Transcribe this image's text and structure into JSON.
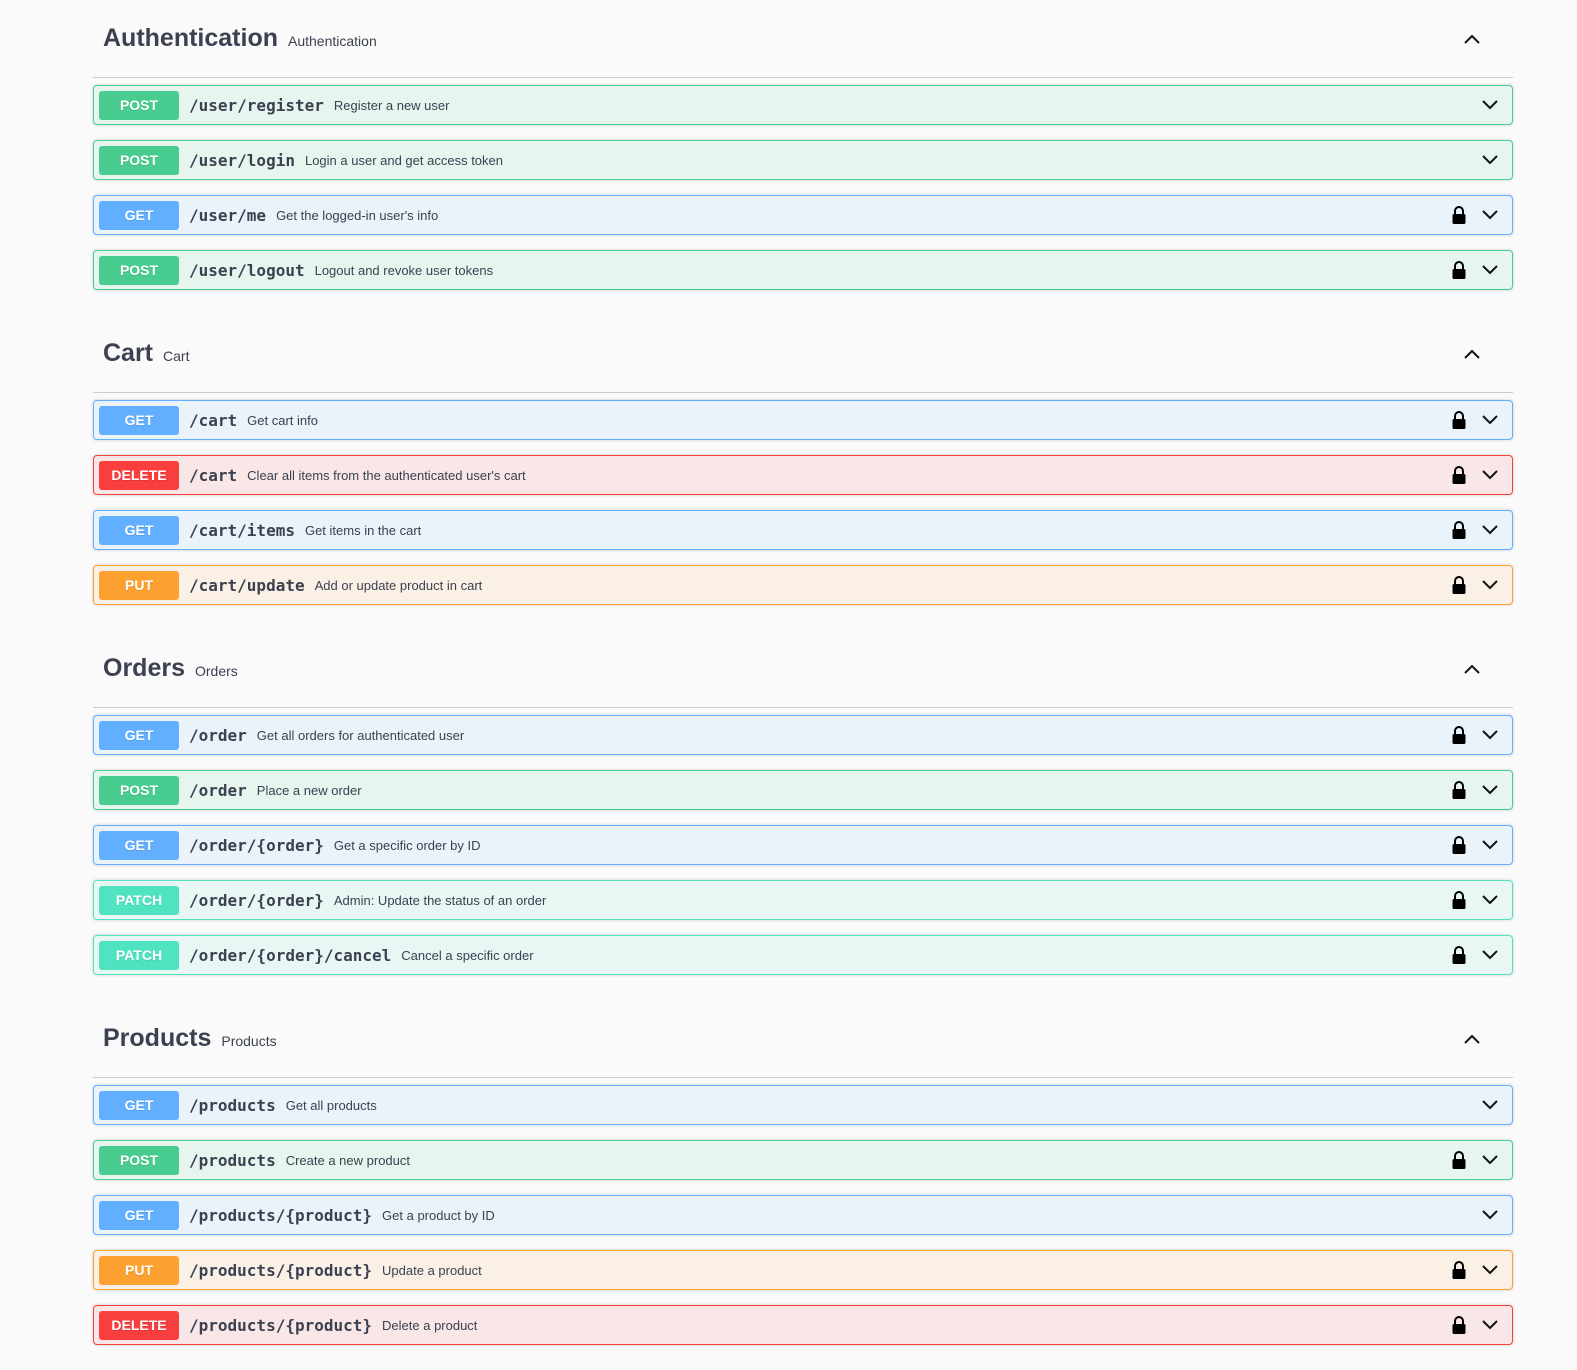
{
  "sections": [
    {
      "title": "Authentication",
      "description": "Authentication",
      "ops": [
        {
          "method": "POST",
          "cls": "post",
          "path": "/user/register",
          "summary": "Register a new user",
          "locked": false
        },
        {
          "method": "POST",
          "cls": "post",
          "path": "/user/login",
          "summary": "Login a user and get access token",
          "locked": false
        },
        {
          "method": "GET",
          "cls": "get",
          "path": "/user/me",
          "summary": "Get the logged-in user's info",
          "locked": true
        },
        {
          "method": "POST",
          "cls": "post",
          "path": "/user/logout",
          "summary": "Logout and revoke user tokens",
          "locked": true
        }
      ]
    },
    {
      "title": "Cart",
      "description": "Cart",
      "ops": [
        {
          "method": "GET",
          "cls": "get",
          "path": "/cart",
          "summary": "Get cart info",
          "locked": true
        },
        {
          "method": "DELETE",
          "cls": "delete",
          "path": "/cart",
          "summary": "Clear all items from the authenticated user's cart",
          "locked": true
        },
        {
          "method": "GET",
          "cls": "get",
          "path": "/cart/items",
          "summary": "Get items in the cart",
          "locked": true
        },
        {
          "method": "PUT",
          "cls": "put",
          "path": "/cart/update",
          "summary": "Add or update product in cart",
          "locked": true
        }
      ]
    },
    {
      "title": "Orders",
      "description": "Orders",
      "ops": [
        {
          "method": "GET",
          "cls": "get",
          "path": "/order",
          "summary": "Get all orders for authenticated user",
          "locked": true
        },
        {
          "method": "POST",
          "cls": "post",
          "path": "/order",
          "summary": "Place a new order",
          "locked": true
        },
        {
          "method": "GET",
          "cls": "get",
          "path": "/order/{order}",
          "summary": "Get a specific order by ID",
          "locked": true
        },
        {
          "method": "PATCH",
          "cls": "patch",
          "path": "/order/{order}",
          "summary": "Admin: Update the status of an order",
          "locked": true
        },
        {
          "method": "PATCH",
          "cls": "patch",
          "path": "/order/{order}/cancel",
          "summary": "Cancel a specific order",
          "locked": true
        }
      ]
    },
    {
      "title": "Products",
      "description": "Products",
      "ops": [
        {
          "method": "GET",
          "cls": "get",
          "path": "/products",
          "summary": "Get all products",
          "locked": false
        },
        {
          "method": "POST",
          "cls": "post",
          "path": "/products",
          "summary": "Create a new product",
          "locked": true
        },
        {
          "method": "GET",
          "cls": "get",
          "path": "/products/{product}",
          "summary": "Get a product by ID",
          "locked": false
        },
        {
          "method": "PUT",
          "cls": "put",
          "path": "/products/{product}",
          "summary": "Update a product",
          "locked": true
        },
        {
          "method": "DELETE",
          "cls": "delete",
          "path": "/products/{product}",
          "summary": "Delete a product",
          "locked": true
        }
      ]
    }
  ],
  "colors": {
    "get": "#61affe",
    "post": "#49cc90",
    "delete": "#f93e3e",
    "put": "#fca130",
    "patch": "#50e3c2"
  },
  "icons": {
    "lock": "lock-icon",
    "expand": "chevron-down-icon",
    "collapse": "chevron-up-icon"
  }
}
